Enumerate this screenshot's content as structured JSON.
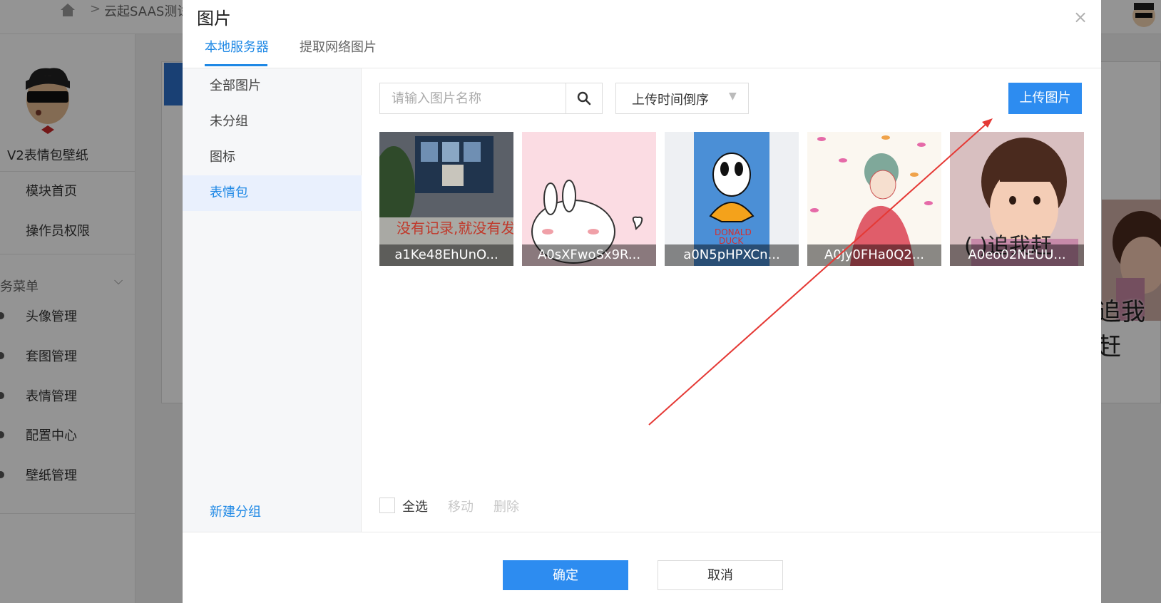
{
  "background": {
    "breadcrumb": "云起SAAS测试",
    "brand_name": "V2表情包壁纸",
    "menu_top": [
      "模块首页",
      "操作员权限"
    ],
    "menu_group": "务菜单",
    "menu_items": [
      "头像管理",
      "套图管理",
      "表情管理",
      "配置中心",
      "壁纸管理"
    ],
    "right_preview_text": "追我赶"
  },
  "modal": {
    "title": "图片",
    "close_icon": "×",
    "tabs": [
      "本地服务器",
      "提取网络图片"
    ],
    "active_tab": 0,
    "groups": [
      "全部图片",
      "未分组",
      "图标",
      "表情包"
    ],
    "active_group": 3,
    "new_group_label": "新建分组",
    "search": {
      "placeholder": "请输入图片名称",
      "value": ""
    },
    "sort": {
      "selected": "上传时间倒序"
    },
    "upload_label": "上传图片",
    "images": [
      {
        "name": "a1Ke48EhUnO..."
      },
      {
        "name": "A0sXFwoSx9R..."
      },
      {
        "name": "a0N5pHPXCn..."
      },
      {
        "name": "A0jy0FHa0Q2..."
      },
      {
        "name": "A0eo02NEUU..."
      }
    ],
    "select_all_label": "全选",
    "move_label": "移动",
    "delete_label": "删除",
    "confirm_label": "确定",
    "cancel_label": "取消"
  },
  "colors": {
    "primary": "#2d8cf0",
    "annotation_arrow": "#e53935"
  }
}
